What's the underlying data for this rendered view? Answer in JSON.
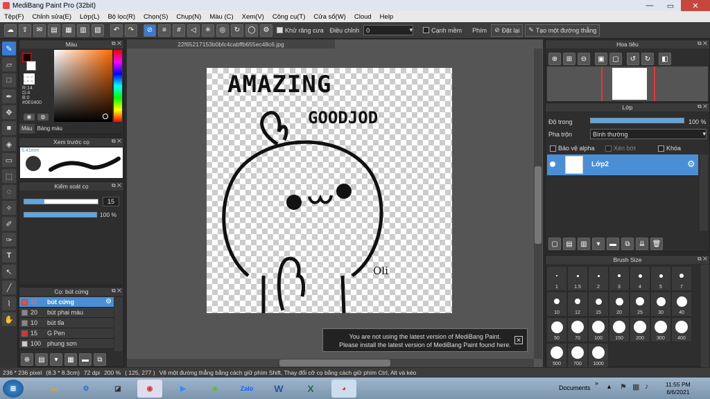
{
  "window": {
    "title": "MediBang Paint Pro (32bit)",
    "min": "—",
    "max": "▭",
    "close": "✕"
  },
  "menu": [
    "Tệp(F)",
    "Chỉnh sửa(E)",
    "Lớp(L)",
    "Bộ lọc(R)",
    "Chọn(S)",
    "Chụp(N)",
    "Màu (C)",
    "Xem(V)",
    "Công cụ(T)",
    "Cửa sổ(W)",
    "Cloud",
    "Help"
  ],
  "toolbar": {
    "antialias_label": "Khử răng cưa",
    "adjust_label": "Điều chỉnh",
    "adjust_value": "0",
    "snap_label": "Cạnh mềm",
    "key_label": "Phím",
    "reset_label": "Đặt lại",
    "straight_line_label": "Tạo một đường thẳng"
  },
  "color_panel": {
    "title": "Màu",
    "r": "R:14",
    "g": "G:4",
    "b": "B:0",
    "hex": "#0E0400",
    "tab_color": "Màu",
    "tab_palette": "Bảng màu",
    "primary_color": "#0e0400"
  },
  "preview_panel": {
    "title": "Xem trước cọ",
    "size": "5.41mm"
  },
  "brush_control": {
    "title": "Kiểm soát cọ",
    "size_value": "15",
    "size_fraction": 0.27,
    "opacity_value": "100 %",
    "opacity_fraction": 1.0
  },
  "brush_list": {
    "title": "Cọ: bút cứng",
    "items": [
      {
        "size": "15",
        "name": "bút cứng",
        "color": "#e05050",
        "selected": true
      },
      {
        "size": "20",
        "name": "bút phai màu",
        "color": "#888888"
      },
      {
        "size": "10",
        "name": "bút tỉa",
        "color": "#888888"
      },
      {
        "size": "15",
        "name": "G Pen",
        "color": "#e03030"
      },
      {
        "size": "100",
        "name": "phung sơn",
        "color": "#cccccc"
      }
    ]
  },
  "document": {
    "tab": "22f65217153b0bfc4cabffb655ec48c6.jpg",
    "text1": "AMAZING",
    "text2": "GOODJOD",
    "signature": "Oli"
  },
  "navigator": {
    "title": "Hoa tiêu"
  },
  "layer_panel": {
    "title": "Lớp",
    "opacity_label": "Độ trong",
    "opacity_value": "100 %",
    "opacity_fraction": 1.0,
    "blend_label": "Pha trộn",
    "blend_value": "Bình thường",
    "protect_alpha": "Bảo vệ alpha",
    "clip": "Xén bớt",
    "lock": "Khóa",
    "layer_name": "Lớp2"
  },
  "brush_size": {
    "title": "Brush Size",
    "sizes": [
      "1",
      "1.5",
      "2",
      "3",
      "4",
      "5",
      "7",
      "10",
      "12",
      "15",
      "20",
      "25",
      "30",
      "40",
      "50",
      "70",
      "100",
      "150",
      "200",
      "300",
      "400",
      "500",
      "700",
      "1000"
    ]
  },
  "notification": {
    "line1": "You are not using the latest version of MediBang Paint.",
    "line2": "Please install the latest version of MediBang Paint found here."
  },
  "status": {
    "dims": "236 * 236 pixel",
    "cm": "(8.3 * 8.3cm)",
    "dpi": "72 dpi",
    "zoom": "200 %",
    "coord": "( 125, 277 )",
    "hint": "Vẽ một đường thẳng bằng cách giữ phím Shift, Thay đổi cỡ cọ bằng cách giữ phím Ctrl, Alt và kéo"
  },
  "taskbar": {
    "documents": "Documents",
    "zalo": "Zalo",
    "time": "11:55 PM",
    "date": "6/6/2021"
  }
}
